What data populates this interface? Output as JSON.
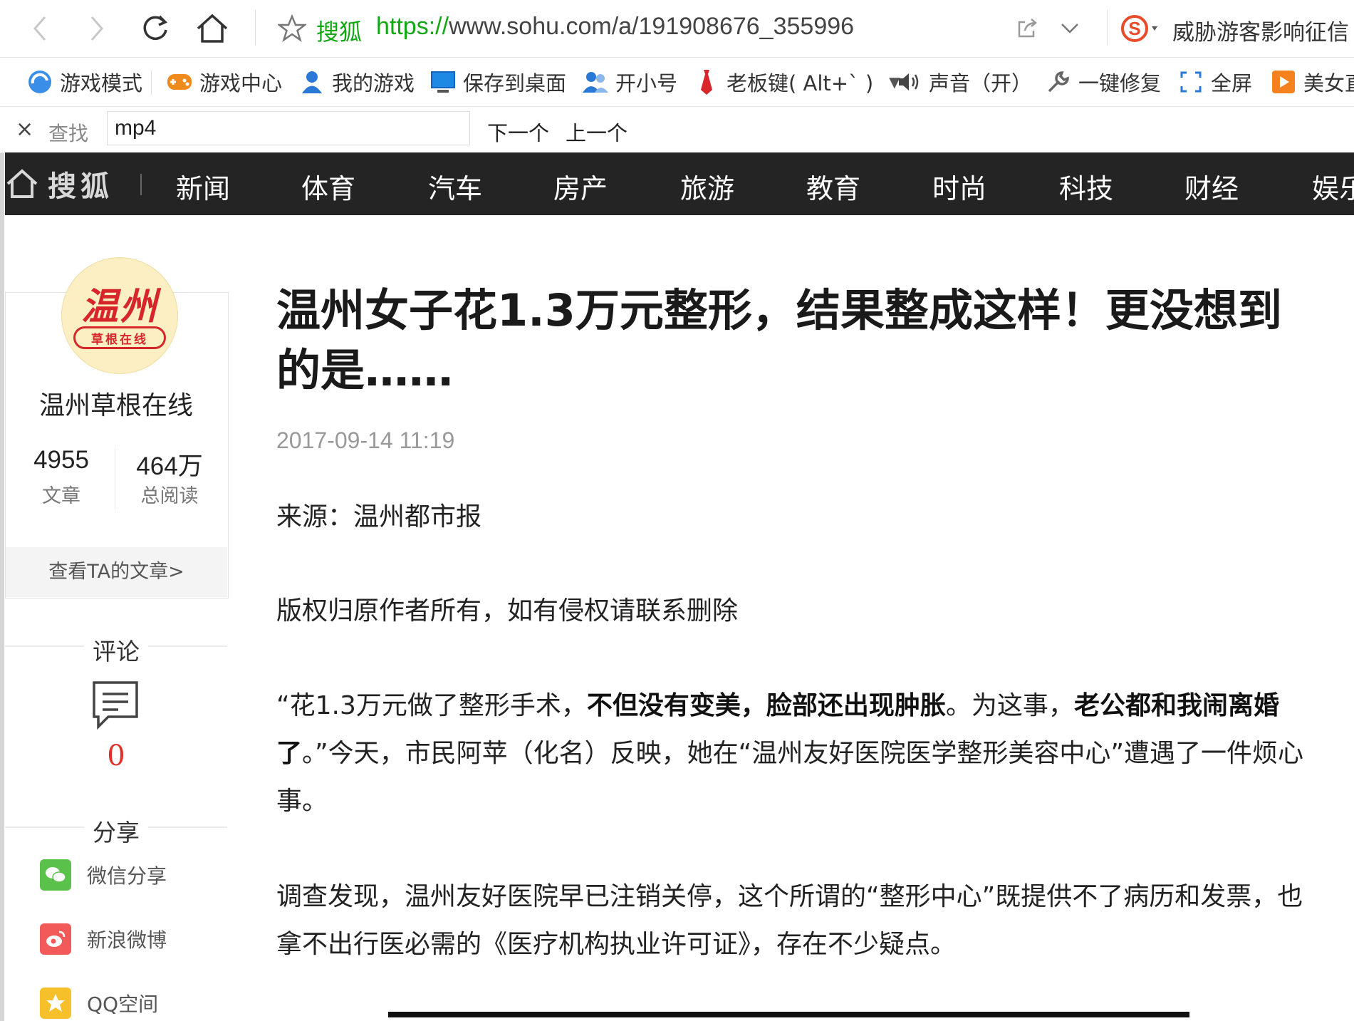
{
  "browser": {
    "site_name": "搜狐",
    "url_protocol": "https://",
    "url_rest": "www.sohu.com/a/191908676_355996",
    "threat_text": "威胁游客影响征信"
  },
  "toolbar": {
    "items": [
      {
        "label": "游戏模式",
        "icon": "game-mode-icon"
      },
      {
        "label": "游戏中心",
        "icon": "gamepad-icon"
      },
      {
        "label": "我的游戏",
        "icon": "user-icon"
      },
      {
        "label": "保存到桌面",
        "icon": "monitor-icon"
      },
      {
        "label": "开小号",
        "icon": "users-icon"
      },
      {
        "label": "老板键( Alt+` )",
        "icon": "tie-icon"
      },
      {
        "label": "声音（开）",
        "icon": "speaker-icon"
      },
      {
        "label": "一键修复",
        "icon": "wrench-icon"
      },
      {
        "label": "全屏",
        "icon": "fullscreen-icon"
      },
      {
        "label": "美女直",
        "icon": "play-icon"
      }
    ]
  },
  "findbar": {
    "close": "×",
    "label": "查找",
    "value": "mp4",
    "next": "下一个",
    "prev": "上一个"
  },
  "sohu_nav": {
    "logo": "搜狐",
    "items": [
      "新闻",
      "体育",
      "汽车",
      "房产",
      "旅游",
      "教育",
      "时尚",
      "科技",
      "财经",
      "娱乐"
    ]
  },
  "author": {
    "avatar_title": "温州",
    "avatar_sub": "草根在线",
    "name": "温州草根在线",
    "articles_count": "4955",
    "articles_label": "文章",
    "reads_count": "464万",
    "reads_label": "总阅读",
    "view_articles": "查看TA的文章>"
  },
  "comments": {
    "title": "评论",
    "count": "0"
  },
  "share": {
    "title": "分享",
    "items": [
      {
        "label": "微信分享",
        "icon": "wechat-icon",
        "color": "#5ac24a"
      },
      {
        "label": "新浪微博",
        "icon": "weibo-icon",
        "color": "#f25a5a"
      },
      {
        "label": "QQ空间",
        "icon": "qzone-icon",
        "color": "#f5c02a"
      }
    ]
  },
  "article": {
    "title": "温州女子花1.3万元整形，结果整成这样！更没想到的是……",
    "time": "2017-09-14 11:19",
    "source": "来源：温州都市报",
    "copyright": "版权归原作者所有，如有侵权请联系删除",
    "p1": {
      "a": "“花1.3万元做了整形手术，",
      "b": "不但没有变美，脸部还出现肿胀",
      "c": "。为这事，",
      "d": "老公都和我闹离婚了",
      "e": "。”今天，市民阿苹（化名）反映，她在“温州友好医院医学整形美容中心”遭遇了一件烦心事。"
    },
    "p2": "调查发现，温州友好医院早已注销关停，这个所谓的“整形中心”既提供不了病历和发票，也拿不出行医必需的《医疗机构执业许可证》，存在不少疑点。"
  }
}
